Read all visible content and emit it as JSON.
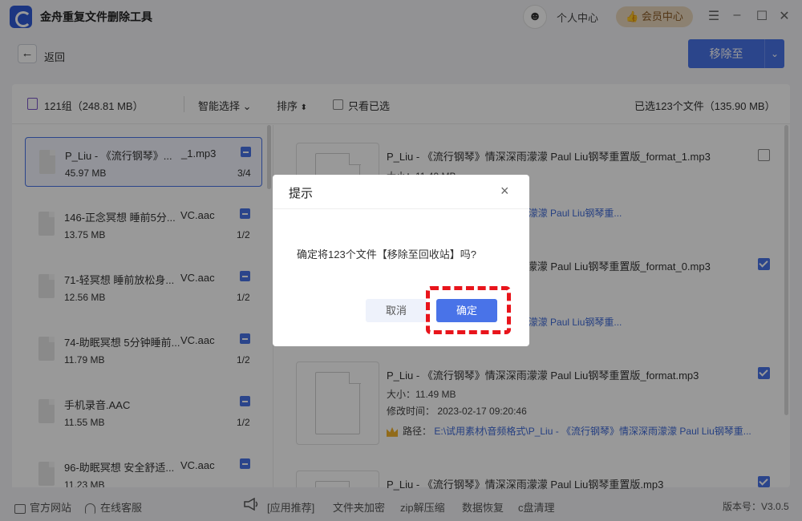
{
  "app": {
    "title": "金舟重复文件删除工具"
  },
  "header": {
    "user_center": "个人中心",
    "vip": "会员中心"
  },
  "toolbar": {
    "back_label": "返回",
    "move_label": "移除至"
  },
  "filter": {
    "groups_summary": "121组（248.81 MB）",
    "smart_select": "智能选择",
    "sort": "排序",
    "only_selected": "只看已选",
    "selected_summary": "已选123个文件（135.90 MB）"
  },
  "groups": [
    {
      "name": "P_Liu - 《流行钢琴》...",
      "ext": "_1.mp3",
      "size": "45.97 MB",
      "count": "3/4"
    },
    {
      "name": "146-正念冥想 睡前5分...",
      "ext": "VC.aac",
      "size": "13.75 MB",
      "count": "1/2"
    },
    {
      "name": "71-轻冥想 睡前放松身...",
      "ext": "VC.aac",
      "size": "12.56 MB",
      "count": "1/2"
    },
    {
      "name": "74-助眠冥想 5分钟睡前...",
      "ext": "VC.aac",
      "size": "11.79 MB",
      "count": "1/2"
    },
    {
      "name": "手机录音.AAC",
      "ext": "",
      "size": "11.55 MB",
      "count": "1/2"
    },
    {
      "name": "96-助眠冥想 安全舒适...",
      "ext": "VC.aac",
      "size": "11.23 MB",
      "count": "1/2"
    }
  ],
  "files": [
    {
      "name": "P_Liu - 《流行钢琴》情深深雨濛濛 Paul Liu钢琴重置版_format_1.mp3",
      "size": "大小：11.49 MB",
      "path": "式\\P_Liu - 《流行钢琴》情深深雨濛濛 Paul Liu钢琴重..."
    },
    {
      "name": "P_Liu - 《流行钢琴》情深深雨濛濛 Paul Liu钢琴重置版_format_0.mp3",
      "path": "式\\P_Liu - 《流行钢琴》情深深雨濛濛 Paul Liu钢琴重..."
    },
    {
      "name": "P_Liu - 《流行钢琴》情深深雨濛濛 Paul Liu钢琴重置版_format.mp3",
      "size": "大小：11.49 MB",
      "modified": "修改时间：  2023-02-17 09:20:46",
      "path_label": "路径：",
      "path": "E:\\试用素材\\音频格式\\P_Liu - 《流行钢琴》情深深雨濛濛 Paul Liu钢琴重..."
    },
    {
      "name": "P_Liu - 《流行钢琴》情深深雨濛濛 Paul Liu钢琴重置版.mp3"
    }
  ],
  "dialog": {
    "title": "提示",
    "message": "确定将123个文件【移除至回收站】吗?",
    "cancel": "取消",
    "ok": "确定",
    "close": "×"
  },
  "statusbar": {
    "website": "官方网站",
    "service": "在线客服",
    "recommend": "[应用推荐]",
    "encrypt": "文件夹加密",
    "zip": "zip解压缩",
    "recovery": "数据恢复",
    "cclean": "c盘清理",
    "version": "版本号：V3.0.5"
  },
  "colors": {
    "accent": "#4973e8",
    "highlight": "#e8141b",
    "vip": "#ead7bd"
  }
}
